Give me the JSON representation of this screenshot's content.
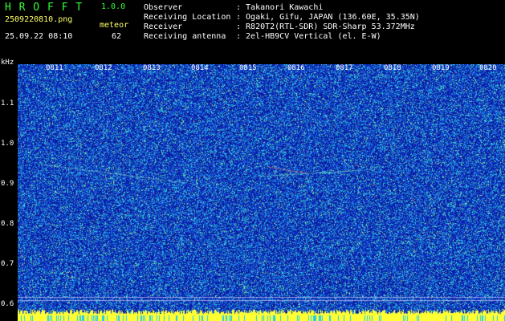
{
  "app": {
    "title": "H R O F F T",
    "version": "1.0.0"
  },
  "file": {
    "name": "2509220810.png",
    "datetime": "25.09.22 08:10"
  },
  "meteor": {
    "label": "meteor",
    "count": "62"
  },
  "info": [
    {
      "label": "Observer",
      "value": ": Takanori Kawachi"
    },
    {
      "label": "Receiving Location",
      "value": ": Ogaki, Gifu, JAPAN (136.60E, 35.35N)"
    },
    {
      "label": "Receiver",
      "value": ": R820T2(RTL-SDR) SDR-Sharp 53.372MHz"
    },
    {
      "label": "Receiving antenna",
      "value": ": 2el-HB9CV Vertical (el. E-W)"
    }
  ],
  "axis": {
    "unit": "kHz",
    "y_ticks": [
      "1.1",
      "1.0",
      "0.9",
      "0.8",
      "0.7",
      "0.6"
    ],
    "time_ticks": [
      "0811",
      "0812",
      "0813",
      "0814",
      "0815",
      "0816",
      "0817",
      "0818",
      "0819",
      "0820"
    ]
  },
  "colors": {
    "green": "#33ff33",
    "yellow": "#ffff66",
    "background": "#0b1a9e",
    "noise_cyan": "#22ccee"
  }
}
